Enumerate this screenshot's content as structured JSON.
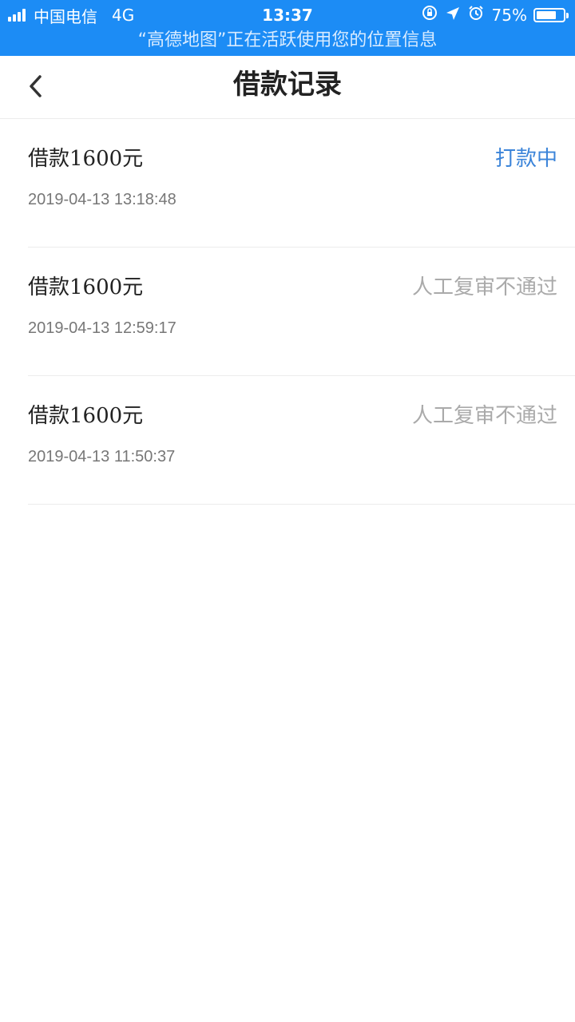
{
  "status_bar": {
    "carrier": "中国电信",
    "network": "4G",
    "time": "13:37",
    "battery_percent": "75%",
    "battery_level": 0.75,
    "location_notice": "“高德地图”正在活跃使用您的位置信息"
  },
  "navbar": {
    "title": "借款记录",
    "back_icon": "chevron-left-icon"
  },
  "records": [
    {
      "amount": "借款1600元",
      "status": "打款中",
      "time": "2019-04-13 13:18:48"
    },
    {
      "amount": "借款1600元",
      "status": "人工复审不通过",
      "time": "2019-04-13 12:59:17"
    },
    {
      "amount": "借款1600元",
      "status": "人工复审不通过",
      "time": "2019-04-13 11:50:37"
    }
  ],
  "colors": {
    "status_bar": "#1c8cf5",
    "active_status": "#3b84d9",
    "inactive_status": "#aaaaaa"
  }
}
